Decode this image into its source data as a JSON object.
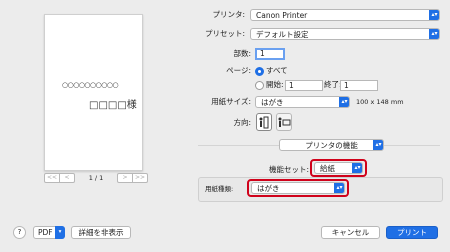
{
  "preview": {
    "circles": "○○○○○○○○○○",
    "boxes_name": "□□□□様",
    "page_indicator": "1 / 1",
    "nav_first": "<<",
    "nav_prev": "<",
    "nav_next": ">",
    "nav_last": ">>"
  },
  "printer": {
    "label": "プリンタ:",
    "value": "Canon Printer"
  },
  "preset": {
    "label": "プリセット:",
    "value": "デフォルト設定"
  },
  "copies": {
    "label": "部数:",
    "value": "1"
  },
  "pages": {
    "label": "ページ:",
    "all_label": "すべて",
    "start_label": "開始:",
    "start_value": "1",
    "end_label": "終了:",
    "end_value": "1"
  },
  "paper_size": {
    "label": "用紙サイズ:",
    "value": "はがき",
    "dimensions": "100 x 148 mm"
  },
  "orientation": {
    "label": "方向:"
  },
  "section": {
    "value": "プリンタの機能"
  },
  "feature_set": {
    "label": "機能セット:",
    "value": "給紙"
  },
  "media_type": {
    "label": "用紙種類:",
    "value": "はがき"
  },
  "footer": {
    "help": "?",
    "pdf": "PDF",
    "hide_details": "詳細を非表示",
    "cancel": "キャンセル",
    "print": "プリント"
  },
  "colors": {
    "accent": "#1f6fe5",
    "highlight": "#d0021b"
  }
}
